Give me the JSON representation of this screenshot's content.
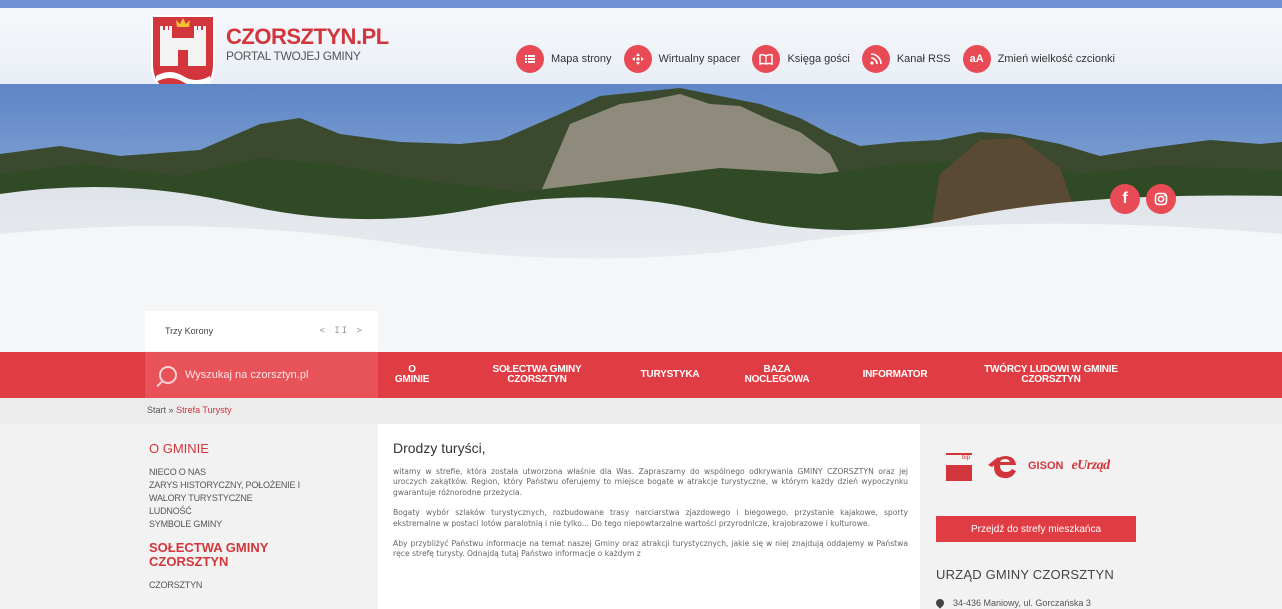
{
  "brand": {
    "name": "CZORSZTYN.PL",
    "tagline": "PORTAL TWOJEJ GMINY"
  },
  "tools": [
    {
      "label": "Mapa strony",
      "icon": "sitemap-icon"
    },
    {
      "label": "Wirtualny spacer",
      "icon": "virtual-tour-icon"
    },
    {
      "label": "Księga gości",
      "icon": "guestbook-icon"
    },
    {
      "label": "Kanał RSS",
      "icon": "rss-icon"
    },
    {
      "label": "Zmień wielkość czcionki",
      "icon": "font-size-icon",
      "glyph": "aA"
    }
  ],
  "social": {
    "facebook": "f",
    "instagram": "instagram-icon"
  },
  "slider": {
    "caption": "Trzy Korony",
    "controls": "< II >"
  },
  "search": {
    "placeholder": "Wyszukaj na czorsztyn.pl"
  },
  "nav": [
    {
      "line1": "O",
      "line2": "GMINIE"
    },
    {
      "line1": "SOŁECTWA GMINY",
      "line2": "CZORSZTYN"
    },
    {
      "line1": "TURYSTYKA",
      "line2": ""
    },
    {
      "line1": "BAZA",
      "line2": "NOCLEGOWA"
    },
    {
      "line1": "INFORMATOR",
      "line2": ""
    },
    {
      "line1": "TWÓRCY LUDOWI W GMINIE",
      "line2": "CZORSZTYN"
    }
  ],
  "breadcrumb": {
    "start": "Start",
    "sep": "»",
    "current": "Strefa Turysty"
  },
  "sidebar": {
    "section1": "O GMINIE",
    "items1": [
      "NIECO O NAS",
      "ZARYS HISTORYCZNY, POŁOŻENIE I",
      "WALORY TURYSTYCZNE",
      "LUDNOŚĆ",
      "SYMBOLE GMINY"
    ],
    "section2_line1": "SOŁECTWA GMINY",
    "section2_line2": "CZORSZTYN",
    "items2": [
      "CZORSZTYN"
    ]
  },
  "main": {
    "heading": "Drodzy turyści,",
    "p1": "witamy w strefie, która została utworzona właśnie dla Was. Zapraszamy do wspólnego odkrywania GMINY CZORSZTYN oraz jej uroczych zakątków. Region, który Państwu oferujemy to miejsce bogate w atrakcje turystyczne, w którym każdy dzień wypoczynku gwarantuje różnorodne przeżycia.",
    "p2": "Bogaty wybór szlaków turystycznych, rozbudowane trasy narciarstwa zjazdowego i biegowego, przystanie kajakowe, sporty ekstremalne w postaci lotów paralotnią i nie tylko... Do tego niepowtarzalne wartości przyrodnicze, krajobrazowe i kulturowe.",
    "p3": "Aby przybliżyć Państwu informacje na temat naszej Gminy oraz atrakcji turystycznych, jakie się w niej znajdują oddajemy w Państwa ręce strefę turysty. Odnajdą tutaj Państwo informacje o każdym z"
  },
  "right": {
    "bip_label": "bip",
    "gison": "GISON",
    "eurzad": "eUrząd",
    "cta": "Przejdź do strefy mieszkańca",
    "office": "URZĄD GMINY CZORSZTYN",
    "address": "34-436 Maniowy, ul. Gorczańska 3"
  },
  "colors": {
    "accent": "#e03c43",
    "brand": "#d2363c"
  }
}
